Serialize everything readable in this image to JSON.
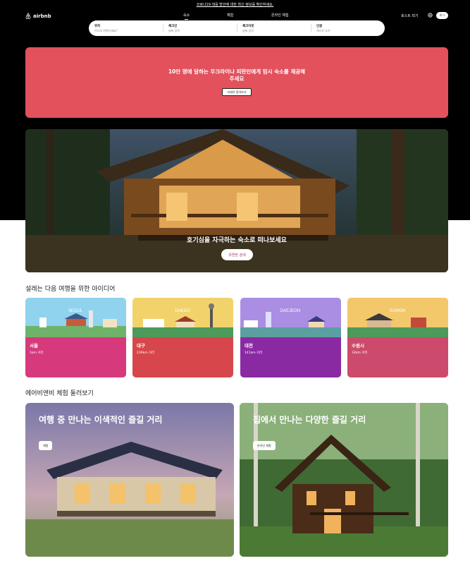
{
  "notice": "코로나19 대응 방안에 대한 최신 정보를 확인하세요.",
  "header": {
    "logo": "airbnb",
    "nav": [
      "숙소",
      "체험",
      "온라인 체험"
    ],
    "host": "호스트 되기",
    "login": "로그"
  },
  "search": {
    "fields": [
      {
        "label": "위치",
        "placeholder": "어디로 여행가세요?"
      },
      {
        "label": "체크인",
        "placeholder": "날짜 입력"
      },
      {
        "label": "체크아웃",
        "placeholder": "날짜 입력"
      },
      {
        "label": "인원",
        "placeholder": "게스트 추가"
      }
    ]
  },
  "banner": {
    "title": "10만 명에 달하는 우크라이나 피란민에게 임시 숙소를 제공해주세요",
    "button": "자세히 알아보기"
  },
  "hero": {
    "caption": "호기심을 자극하는 숙소로 떠나보세요",
    "button": "유연한 검색"
  },
  "ideas": {
    "title": "설레는 다음 여행을 위한 아이디어",
    "cards": [
      {
        "city": "서울",
        "distance": "1km 거리",
        "label": "SEOUL",
        "color": "#d63a7d",
        "sky": "#8fd3ef"
      },
      {
        "city": "대구",
        "distance": "239km 거리",
        "label": "DAEGU",
        "color": "#d6464a",
        "sky": "#f2d36b"
      },
      {
        "city": "대전",
        "distance": "141km 거리",
        "label": "DAEJEON",
        "color": "#8a2aa3",
        "sky": "#a98ee4"
      },
      {
        "city": "수원시",
        "distance": "32km 거리",
        "label": "SUWON",
        "color": "#cc4a6b",
        "sky": "#f2c86b"
      }
    ]
  },
  "experiences": {
    "title": "에어비앤비 체험 둘러보기",
    "cards": [
      {
        "title": "여행 중 만나는 이색적인 즐길 거리",
        "button": "체험"
      },
      {
        "title": "집에서 만나는 다양한 즐길 거리",
        "button": "온라인 체험"
      }
    ]
  }
}
